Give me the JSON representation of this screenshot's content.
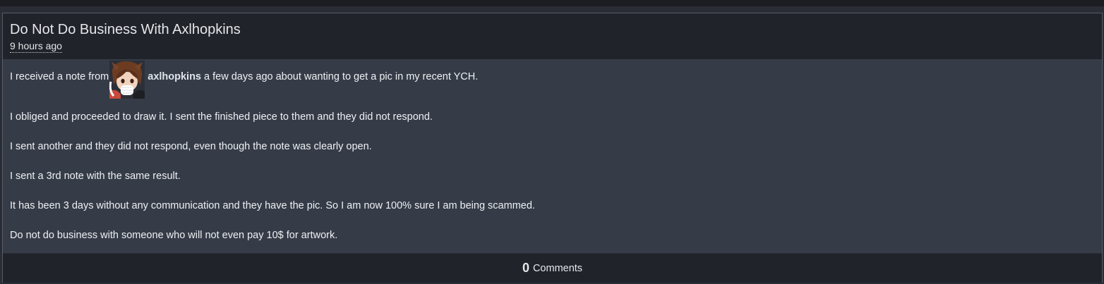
{
  "journal": {
    "title": "Do Not Do Business With Axlhopkins",
    "posted": "9 hours ago",
    "body": {
      "intro_before": "I received a note from",
      "username": "axlhopkins",
      "intro_after": "a few days ago about wanting to get a pic in my recent YCH.",
      "paragraphs": [
        "I obliged and proceeded to draw it. I sent the finished piece to them and they did not respond.",
        "I sent another and they did not respond, even though the note was clearly open.",
        "I sent a 3rd note with the same result.",
        "It has been 3 days without any communication and they have the pic. So I am now 100% sure I am being scammed.",
        "Do not do business with someone who will not even pay 10$ for artwork."
      ]
    },
    "comments": {
      "count": "0",
      "label": "Comments"
    }
  },
  "colors": {
    "page_bg": "#2a2d35",
    "header_bg": "#20232a",
    "body_bg": "#363c47",
    "border": "#585c66",
    "text": "#eef0f4"
  },
  "icons": {
    "avatar": "user-avatar-icon"
  }
}
